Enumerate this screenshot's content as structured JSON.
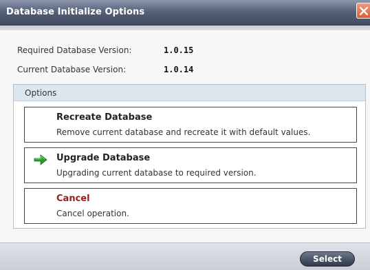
{
  "window": {
    "title": "Database Initialize Options"
  },
  "versions": {
    "required_label": "Required Database Version:",
    "required_value": "1.0.15",
    "current_label": "Current Database Version:",
    "current_value": "1.0.14"
  },
  "options": {
    "header": "Options",
    "items": [
      {
        "title": "Recreate Database",
        "description": "Remove current database and recreate it with default values.",
        "selected": false
      },
      {
        "title": "Upgrade Database",
        "description": "Upgrading current database to required version.",
        "selected": true
      },
      {
        "title": "Cancel",
        "description": "Cancel operation.",
        "selected": false
      }
    ]
  },
  "footer": {
    "select_label": "Select"
  },
  "icons": {
    "close": "close-icon",
    "selected_arrow": "arrow-right-icon"
  },
  "colors": {
    "selected_arrow": "#2a9a2a",
    "cancel_title": "#9a1c1c",
    "close_button": "#e05a31"
  }
}
